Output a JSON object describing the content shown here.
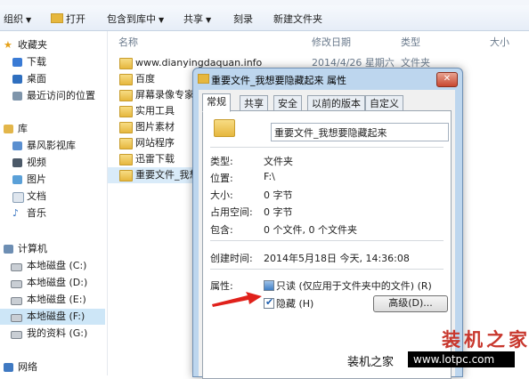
{
  "toolbar": {
    "organize": "组织",
    "open": "打开",
    "include_library": "包含到库中",
    "share": "共享",
    "burn": "刻录",
    "new_folder": "新建文件夹"
  },
  "nav": {
    "favorites": "收藏夹",
    "downloads": "下载",
    "desktop": "桌面",
    "recent": "最近访问的位置",
    "libraries": "库",
    "baofeng": "暴风影视库",
    "videos": "视频",
    "pictures": "图片",
    "documents": "文档",
    "music": "音乐",
    "computer": "计算机",
    "disk_c": "本地磁盘 (C:)",
    "disk_d": "本地磁盘 (D:)",
    "disk_e": "本地磁盘 (E:)",
    "disk_f": "本地磁盘 (F:)",
    "my_data": "我的资料 (G:)",
    "network": "网络"
  },
  "columns": {
    "name": "名称",
    "modified": "修改日期",
    "type": "类型",
    "size": "大小"
  },
  "files": [
    {
      "name": "www.dianyingdaquan.info",
      "date": "2014/4/26 星期六",
      "type": "文件夹"
    },
    {
      "name": "百度"
    },
    {
      "name": "屏幕录像专家"
    },
    {
      "name": "实用工具"
    },
    {
      "name": "图片素材"
    },
    {
      "name": "网站程序"
    },
    {
      "name": "迅雷下载"
    },
    {
      "name": "重要文件_我想"
    }
  ],
  "dialog": {
    "title": "重要文件_我想要隐藏起来 属性",
    "close": "✕",
    "tabs": [
      "常规",
      "共享",
      "安全",
      "以前的版本",
      "自定义"
    ],
    "name_value": "重要文件_我想要隐藏起来",
    "type_label": "类型:",
    "type_value": "文件夹",
    "location_label": "位置:",
    "location_value": "F:\\",
    "size_label": "大小:",
    "size_value": "0 字节",
    "disk_size_label": "占用空间:",
    "disk_size_value": "0 字节",
    "contains_label": "包含:",
    "contains_value": "0 个文件, 0 个文件夹",
    "created_label": "创建时间:",
    "created_value": "2014年5月18日 今天, 14:36:08",
    "attributes_label": "属性:",
    "readonly_label": "只读 (仅应用于文件夹中的文件) (R)",
    "hidden_label": "隐藏 (H)",
    "hidden_checked": true,
    "advanced_button": "高级(D)..."
  },
  "watermark": {
    "logo": "装机之家",
    "text": "装机之家",
    "url": "www.lotpc.com"
  },
  "colors": {
    "arrow": "#e0211b",
    "watermark_red": "#c8372d",
    "selection": "#cde6f7"
  }
}
